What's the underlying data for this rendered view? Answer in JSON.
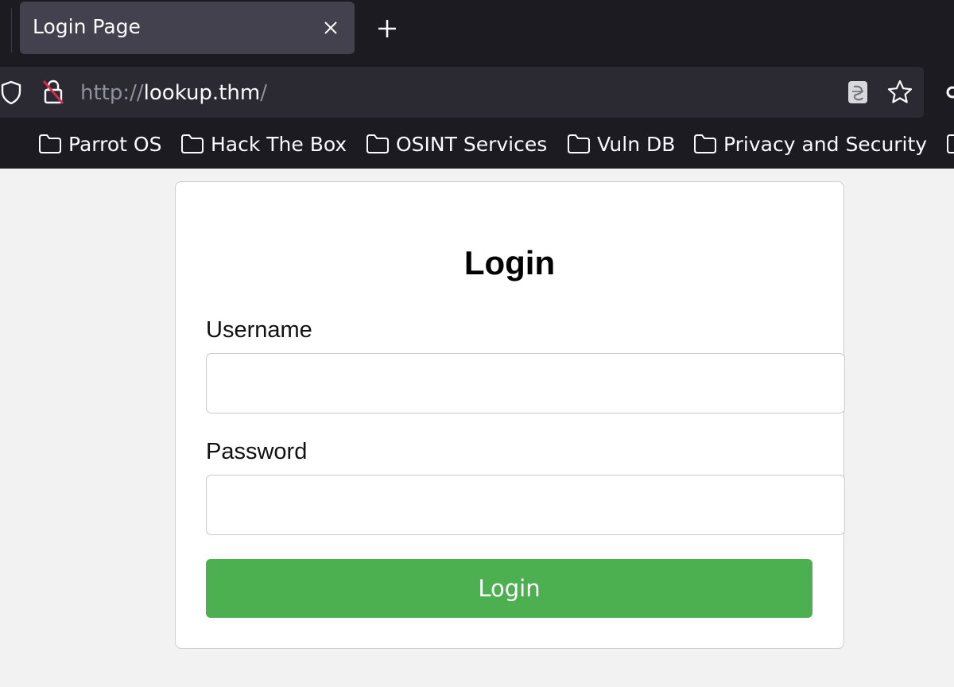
{
  "browser": {
    "tab": {
      "title": "Login Page"
    },
    "url": {
      "scheme": "http://",
      "host": "lookup.thm",
      "path": "/"
    },
    "bookmarks": [
      {
        "label": "Parrot OS",
        "icon": "folder-icon"
      },
      {
        "label": "Hack The Box",
        "icon": "folder-icon"
      },
      {
        "label": "OSINT Services",
        "icon": "folder-icon"
      },
      {
        "label": "Vuln DB",
        "icon": "folder-icon"
      },
      {
        "label": "Privacy and Security",
        "icon": "folder-icon"
      }
    ],
    "icons": [
      "close-icon",
      "plus-icon",
      "shield-icon",
      "insecure-lock-icon",
      "translate-icon",
      "star-icon"
    ]
  },
  "page": {
    "title": "Login",
    "username": {
      "label": "Username",
      "value": ""
    },
    "password": {
      "label": "Password",
      "value": ""
    },
    "submit_label": "Login"
  },
  "colors": {
    "chrome_bg": "#1c1b22",
    "tab_active": "#42414d",
    "urlbar_bg": "#2b2a33",
    "page_bg": "#f2f2f2",
    "button_green": "#4caf50",
    "insecure_red": "#e22850"
  }
}
